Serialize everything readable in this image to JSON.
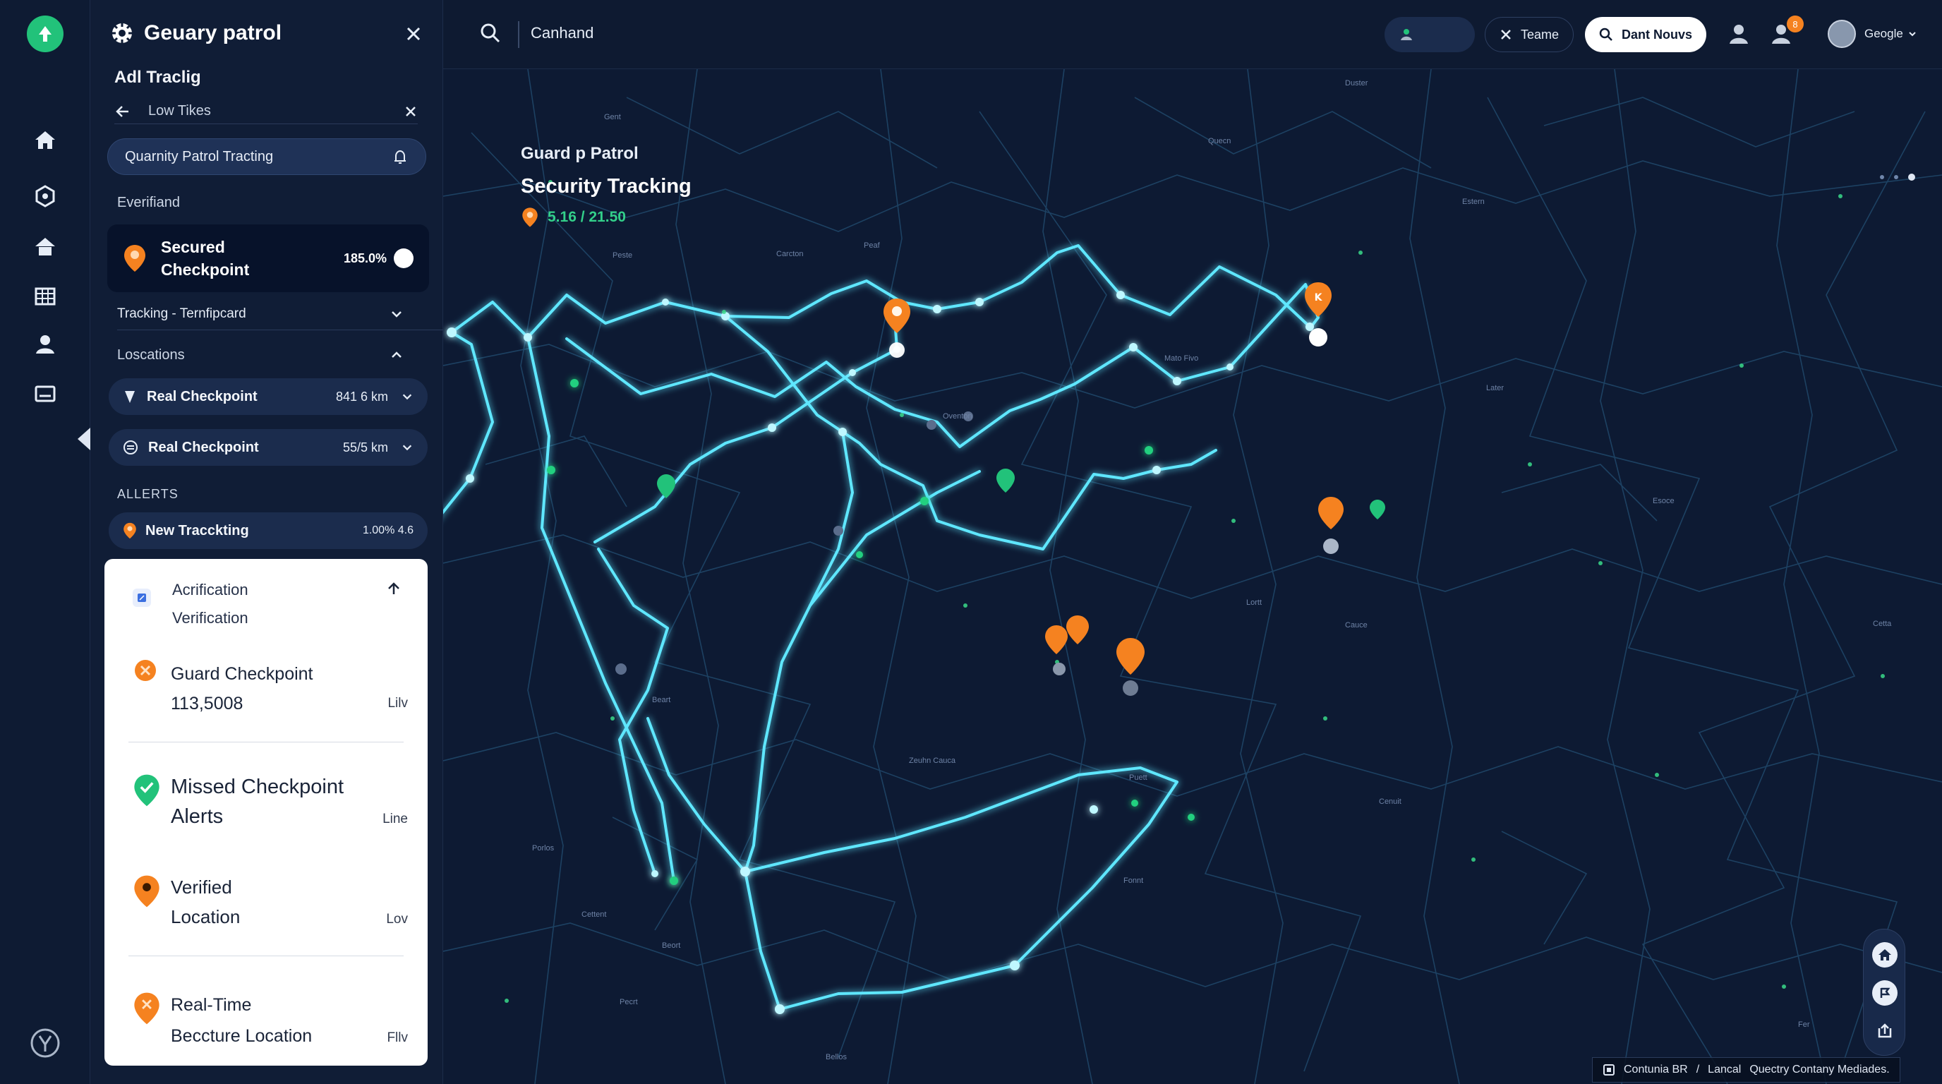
{
  "brand": {
    "name": "Geuary patrol",
    "subtitle": "Adl Traclig"
  },
  "panel": {
    "back_label": "Low Tikes",
    "search_pill": "Quarnity Patrol Tracting",
    "verified_label": "Everifiand",
    "secured": {
      "title": "Secured Checkpoint",
      "percent": "185.0%"
    },
    "tracking_dropdown": "Tracking - Ternfipcard",
    "locations_label": "Loscations",
    "locations": [
      {
        "label": "Real Checkpoint",
        "value": "841 6 km",
        "icon": "pin-icon"
      },
      {
        "label": "Real Checkpoint",
        "value": "55/5 km",
        "icon": "target-icon"
      }
    ],
    "alerts_label": "ALLERTS",
    "alert_row": {
      "label": "New Tracckting",
      "value": "1.00% 4.6"
    }
  },
  "alerts_card": {
    "header_line1": "Acrification",
    "header_line2": "Verification",
    "items": [
      {
        "title1": "Guard Checkpoint",
        "title2": "113,5008",
        "tag": "Lilv",
        "color": "#f58220"
      },
      {
        "title1": "Missed Checkpoint",
        "title2": "Alerts",
        "tag": "Line",
        "color": "#22c27a"
      },
      {
        "title1": "Verified",
        "title2": "Location",
        "tag": "Lov",
        "color": "#f58220"
      },
      {
        "title1": "Real-Time",
        "title2": "Beccture Location",
        "tag": "Fllv",
        "color": "#f58220"
      }
    ]
  },
  "topbar": {
    "command": "Canhand",
    "teams_label": "Teame",
    "news_label": "Dant Nouvs",
    "badge": "8",
    "account_name": "Geogle"
  },
  "map": {
    "title1": "Guard p Patrol",
    "title2": "Security Tracking",
    "stat": "5.16 / 21.50",
    "attribution": [
      "Contunia BR",
      "/",
      "Lancal",
      "Quectry Contany Mediades."
    ],
    "labels": [
      "Duster",
      "Gent",
      "Quecn",
      "Estern",
      "Peste",
      "Carcton",
      "Peaf",
      "Mato Fivo",
      "Oventon",
      "Later",
      "Esoce",
      "Lortt",
      "Cauce",
      "Beart",
      "Zeuhn Cauca",
      "Puett",
      "Cenuit",
      "Porlos",
      "Cettent",
      "Fonnt",
      "Beort",
      "Pecrt",
      "Bellos",
      "Cetta",
      "Fer"
    ],
    "accent_line": "#55e6ff",
    "marker_orange": "#f58220",
    "marker_green": "#22c27a"
  }
}
